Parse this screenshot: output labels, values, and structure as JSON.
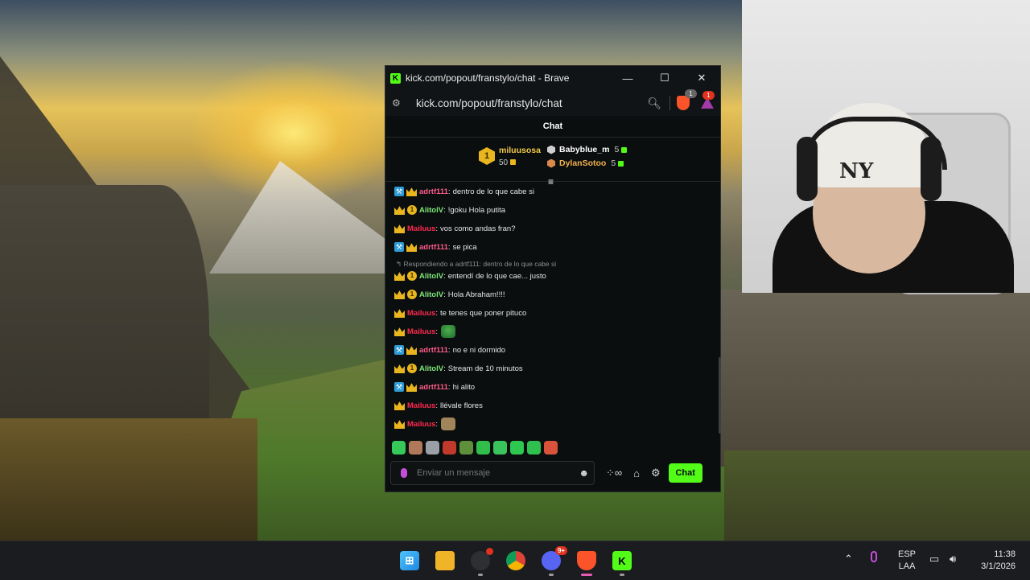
{
  "window": {
    "title": "kick.com/popout/franstylo/chat - Brave",
    "logo_letter": "K",
    "controls": {
      "minimize": "—",
      "maximize": "☐",
      "close": "✕"
    }
  },
  "address_bar": {
    "url": "kick.com/popout/franstylo/chat",
    "shield_badge": "1",
    "rewards_badge": "1"
  },
  "chat": {
    "header": "Chat",
    "leaderboard": {
      "top": {
        "rank": "1",
        "name": "miluusosa",
        "score": "50"
      },
      "others": [
        {
          "name": "Babyblue_m",
          "score": "5"
        },
        {
          "name": "DylanSotoo",
          "score": "5"
        }
      ]
    },
    "messages": [
      {
        "user": "adrtf111",
        "text": "dentro de lo que cabe si"
      },
      {
        "user": "AlitolV",
        "text": "!goku Hola putita"
      },
      {
        "user": "Mailuus",
        "text": "vos como andas fran?"
      },
      {
        "user": "adrtf111",
        "text": "se pica"
      },
      {
        "user": "AlitolV",
        "text": "entendí de lo que cae... justo"
      },
      {
        "user": "AlitolV",
        "text": "Hola Abraham!!!!"
      },
      {
        "user": "Mailuus",
        "text": "te tenes que poner pituco"
      },
      {
        "user": "Mailuus",
        "text": ""
      },
      {
        "user": "adrtf111",
        "text": "no e ni dormido"
      },
      {
        "user": "AlitolV",
        "text": "Stream de 10 minutos"
      },
      {
        "user": "adrtf111",
        "text": "hi alito"
      },
      {
        "user": "Mailuus",
        "text": "llévale flores"
      },
      {
        "user": "Mailuus",
        "text": ""
      }
    ],
    "reply_context": "Respondiendo a adrtf111: dentro de lo que cabe si",
    "input_placeholder": "Enviar un mensaje",
    "send_label": "Chat"
  },
  "webcam": {
    "beanie_logo": "NY"
  },
  "taskbar": {
    "chrome_badge": "",
    "discord_badge": "9+",
    "language": "ESP",
    "layout": "LAA",
    "time": "11:38",
    "date": "3/1/2026"
  },
  "colors": {
    "kick_green": "#53fc18",
    "gold": "#e9b61f",
    "username_pink": "#ff5c8a",
    "username_red": "#ff2a4f",
    "username_green": "#7fe87a",
    "mod_badge": "#2e9bd6"
  }
}
